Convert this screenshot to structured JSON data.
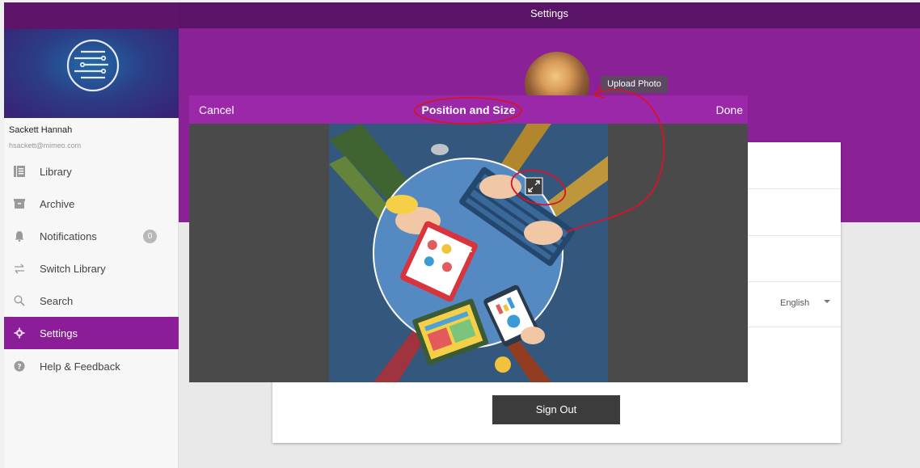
{
  "app_bar": {
    "title": "Settings"
  },
  "profile": {
    "name": "Sackett Hannah",
    "email": "hsackett@mimeo.com"
  },
  "sidebar": {
    "items": [
      {
        "label": "Library",
        "icon": "library-icon"
      },
      {
        "label": "Archive",
        "icon": "archive-icon"
      },
      {
        "label": "Notifications",
        "icon": "bell-icon",
        "badge": "0"
      },
      {
        "label": "Switch Library",
        "icon": "switch-icon"
      },
      {
        "label": "Search",
        "icon": "search-icon"
      },
      {
        "label": "Settings",
        "icon": "gear-icon",
        "active": true
      },
      {
        "label": "Help & Feedback",
        "icon": "help-icon"
      }
    ]
  },
  "upload_tooltip": "Upload Photo",
  "language": {
    "selected": "English"
  },
  "sign_out_label": "Sign Out",
  "crop_modal": {
    "cancel_label": "Cancel",
    "title": "Position and Size",
    "done_label": "Done"
  },
  "colors": {
    "accent": "#8b1e98",
    "app_bar": "#5a1467",
    "annotation": "#d4142a"
  }
}
